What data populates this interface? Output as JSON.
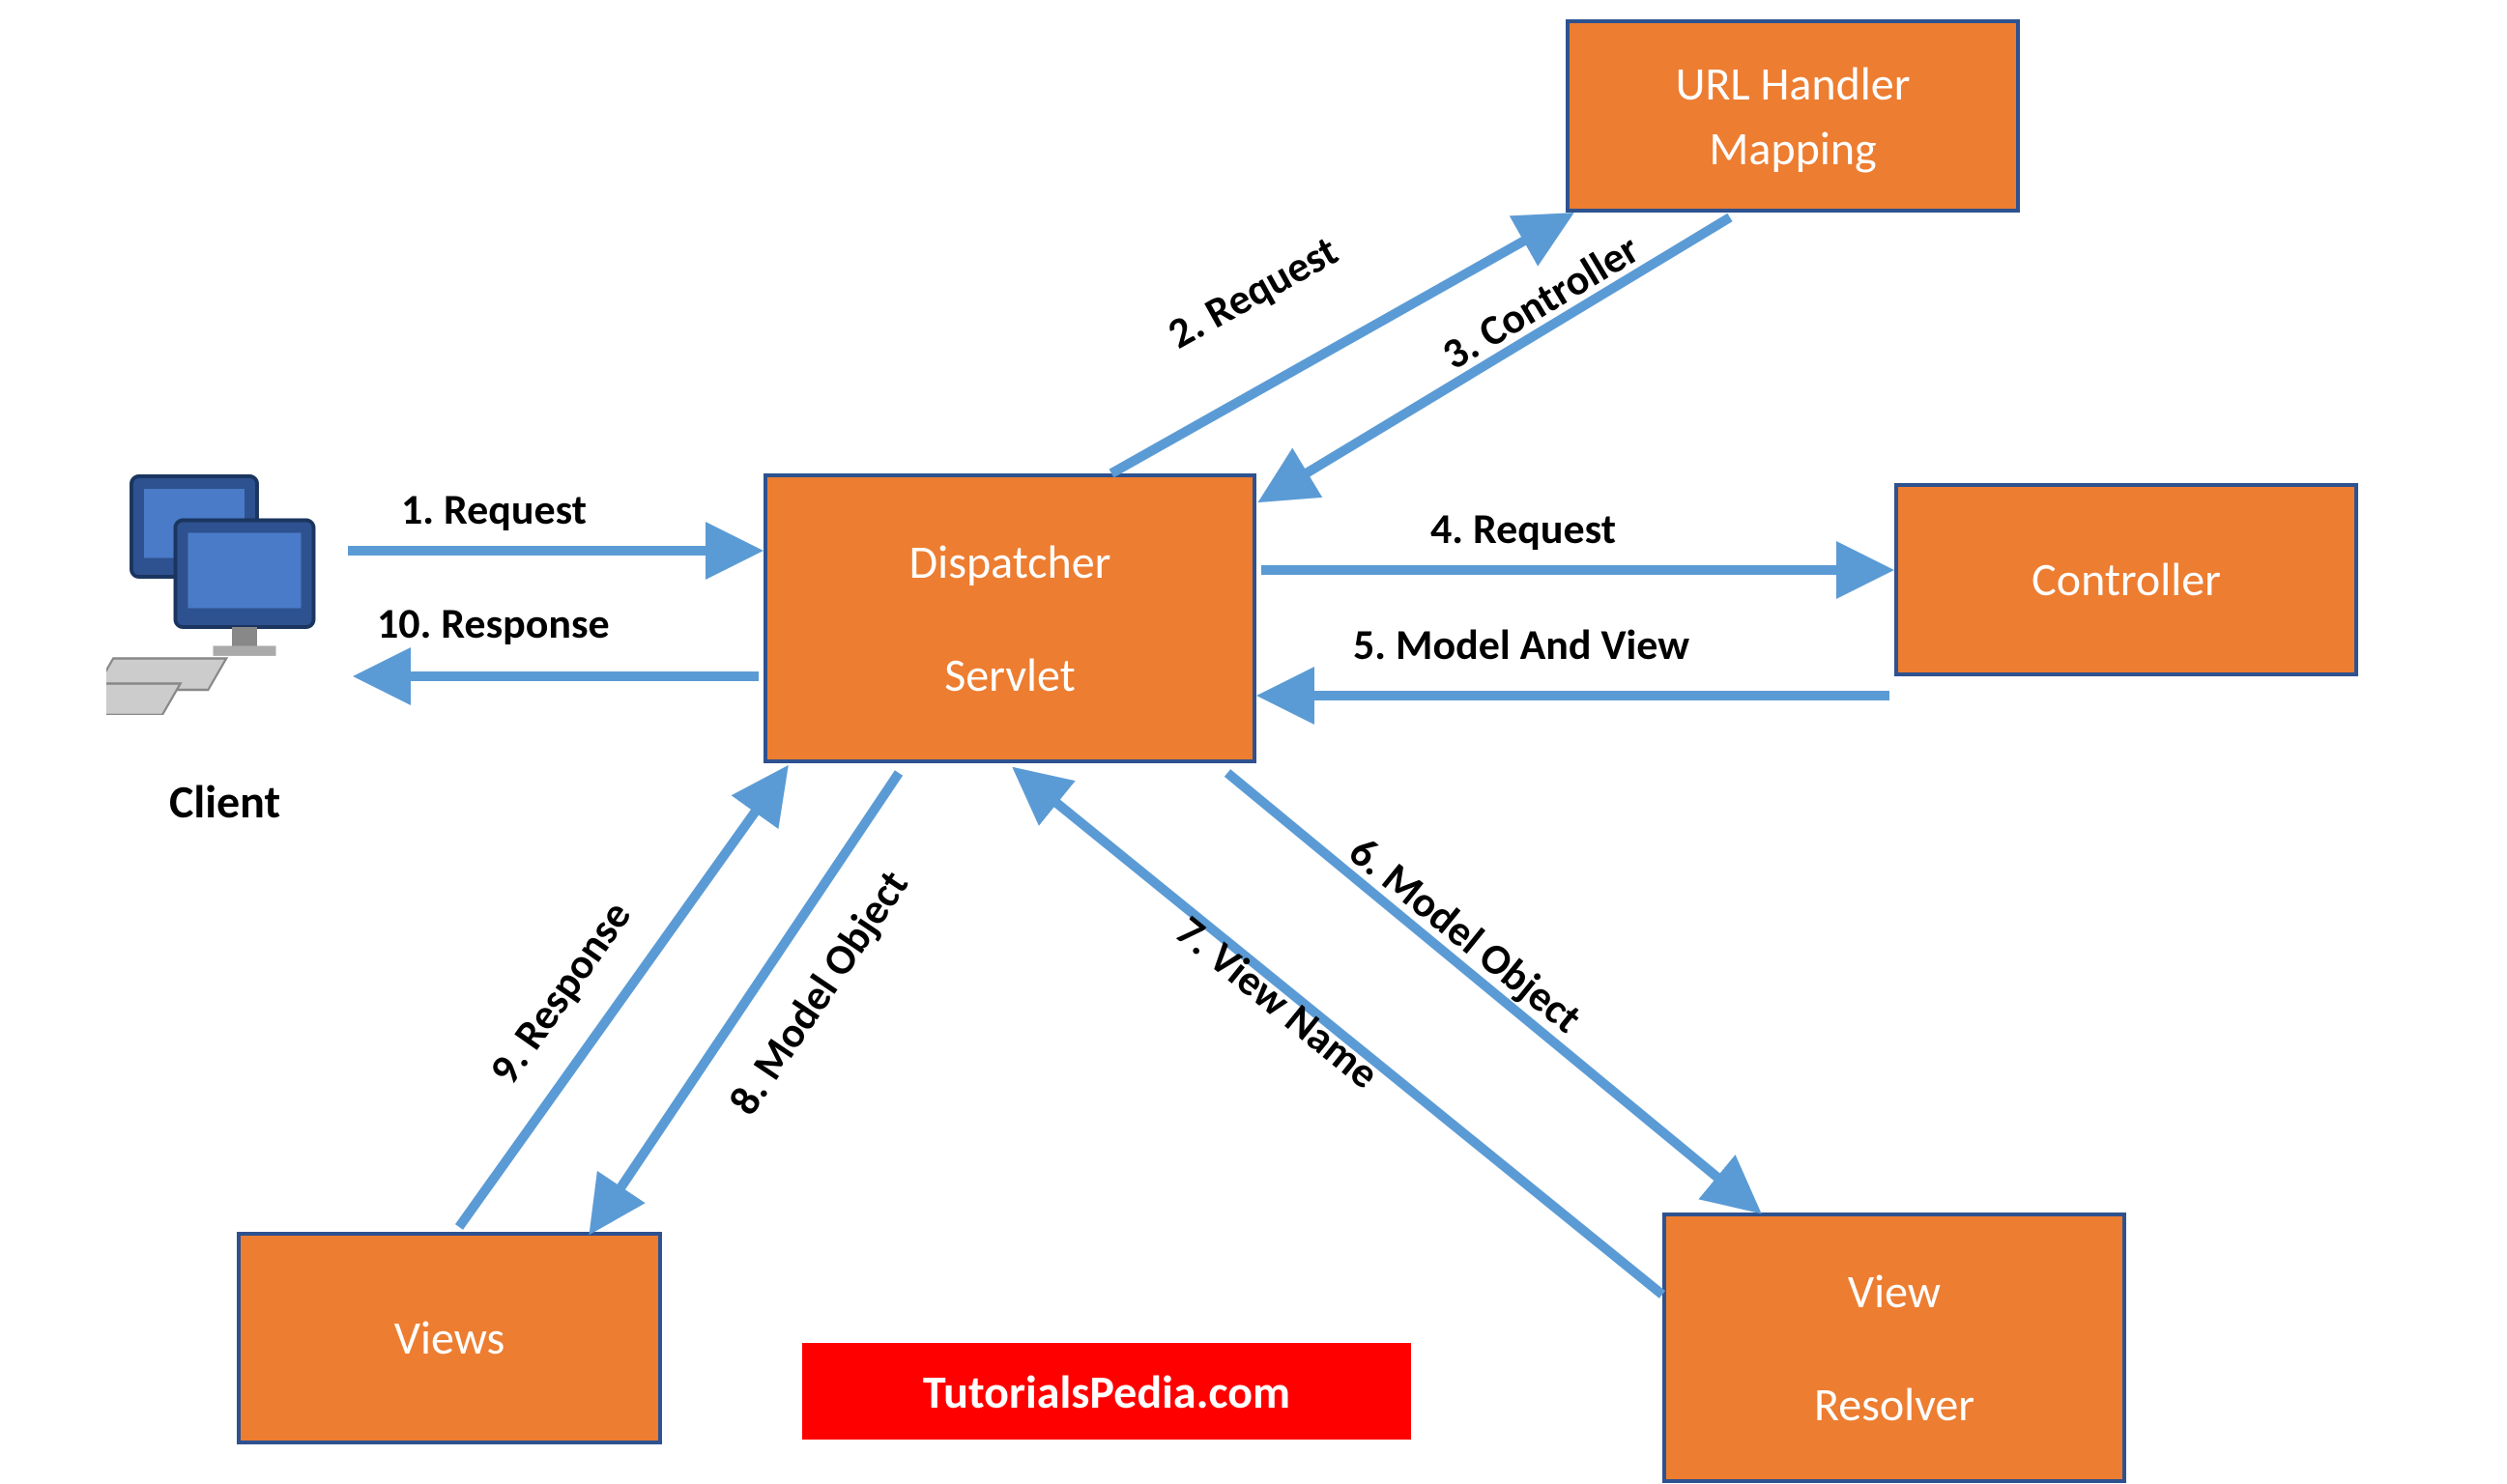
{
  "nodes": {
    "client": "Client",
    "dispatcher_line1": "Dispatcher",
    "dispatcher_line2": "Servlet",
    "url_handler_line1": "URL Handler",
    "url_handler_line2": "Mapping",
    "controller": "Controller",
    "views": "Views",
    "view_resolver_line1": "View",
    "view_resolver_line2": "Resolver"
  },
  "edges": {
    "e1": "1. Request",
    "e2": "2. Request",
    "e3": "3. Controller",
    "e4": "4. Request",
    "e5": "5. Model And View",
    "e6": "6. Model Object",
    "e7": "7. View Name",
    "e8": "8. Model Object",
    "e9": "9. Response",
    "e10": "10. Response"
  },
  "watermark": "TutorialsPedia.com",
  "colors": {
    "box_fill": "#ED7D31",
    "box_border": "#2E528F",
    "arrow": "#5B9BD5",
    "watermark_bg": "#FF0000"
  }
}
